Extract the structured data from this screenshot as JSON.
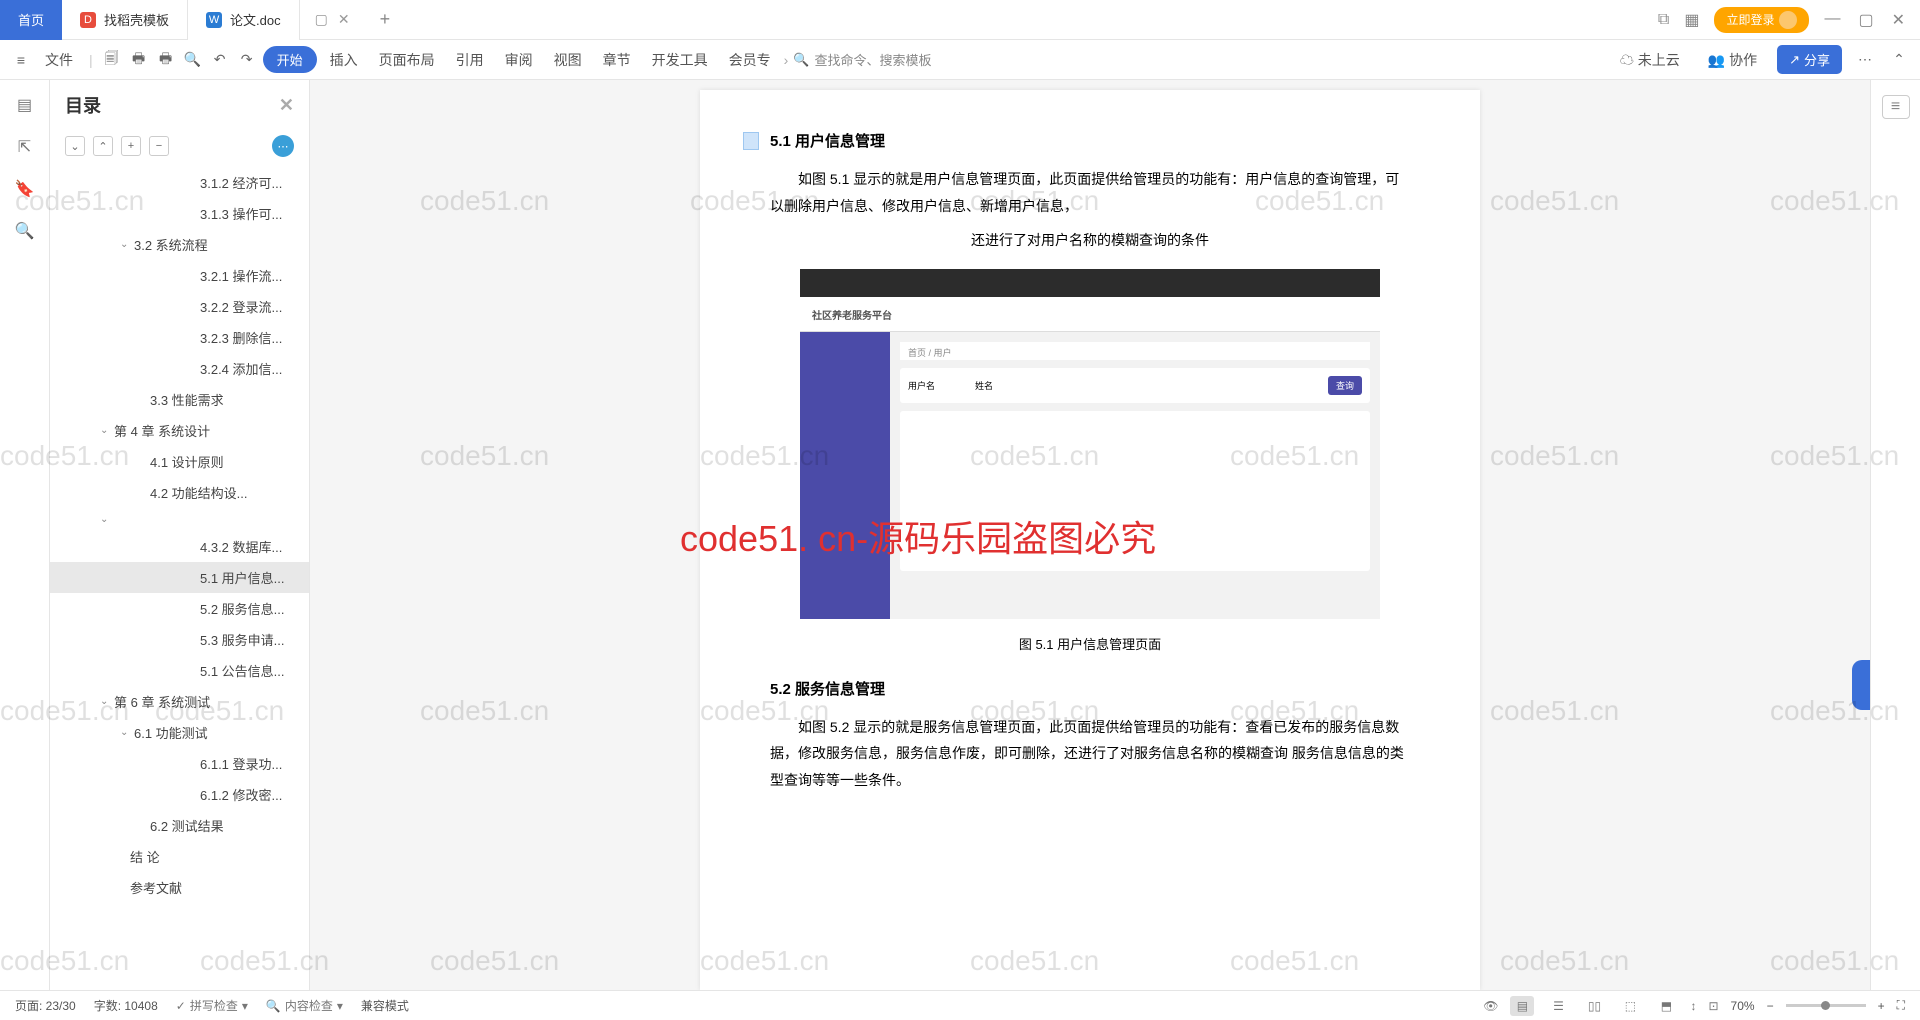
{
  "tabs": {
    "home": "首页",
    "templates": "找稻壳模板",
    "doc": "论文.doc"
  },
  "title_right": {
    "login": "立即登录"
  },
  "toolbar": {
    "file": "文件",
    "start": "开始",
    "insert": "插入",
    "layout": "页面布局",
    "refs": "引用",
    "review": "审阅",
    "view": "视图",
    "chapter": "章节",
    "dev": "开发工具",
    "member": "会员专",
    "search": "查找命令、搜索模板",
    "cloud": "未上云",
    "collab": "协作",
    "share": "分享"
  },
  "outline": {
    "title": "目录",
    "items": [
      {
        "label": "3.1.2 经济可...",
        "lvl": "ol-lv2"
      },
      {
        "label": "3.1.3 操作可...",
        "lvl": "ol-lv2"
      },
      {
        "label": "3.2 系统流程",
        "lvl": "ol-lv1c",
        "chev": "⌄"
      },
      {
        "label": "3.2.1 操作流...",
        "lvl": "ol-lv2"
      },
      {
        "label": "3.2.2 登录流...",
        "lvl": "ol-lv2"
      },
      {
        "label": "3.2.3 删除信...",
        "lvl": "ol-lv2"
      },
      {
        "label": "3.2.4 添加信...",
        "lvl": "ol-lv2"
      },
      {
        "label": "3.3 性能需求",
        "lvl": "ol-lv1"
      },
      {
        "label": "第 4 章  系统设计",
        "lvl": "ol-lv0c",
        "chev": "⌄"
      },
      {
        "label": "4.1 设计原则",
        "lvl": "ol-lv1"
      },
      {
        "label": "4.2 功能结构设...",
        "lvl": "ol-lv1"
      },
      {
        "label": "",
        "lvl": "ol-lv0c",
        "chev": "⌄"
      },
      {
        "label": "4.3.2 数据库...",
        "lvl": "ol-lv2"
      },
      {
        "label": "5.1 用户信息...",
        "lvl": "ol-lv2",
        "selected": true
      },
      {
        "label": "5.2 服务信息...",
        "lvl": "ol-lv2"
      },
      {
        "label": "5.3 服务申请...",
        "lvl": "ol-lv2"
      },
      {
        "label": "5.1 公告信息...",
        "lvl": "ol-lv2"
      },
      {
        "label": "第 6 章  系统测试",
        "lvl": "ol-lv0c",
        "chev": "⌄"
      },
      {
        "label": "6.1 功能测试",
        "lvl": "ol-lv1c",
        "chev": "⌄"
      },
      {
        "label": "6.1.1 登录功...",
        "lvl": "ol-lv2"
      },
      {
        "label": "6.1.2 修改密...",
        "lvl": "ol-lv2"
      },
      {
        "label": "6.2 测试结果",
        "lvl": "ol-lv1"
      },
      {
        "label": "结   论",
        "lvl": "ol-lv0"
      },
      {
        "label": "参考文献",
        "lvl": "ol-lv0"
      }
    ]
  },
  "doc": {
    "h51": "5.1 用户信息管理",
    "p51a": "如图 5.1 显示的就是用户信息管理页面，此页面提供给管理员的功能有：用户信息的查询管理，可以删除用户信息、修改用户信息、新增用户信息，",
    "p51b": "还进行了对用户名称的模糊查询的条件",
    "figapp": "社区养老服务平台",
    "figcap": "图 5.1  用户信息管理页面",
    "h52": "5.2  服务信息管理",
    "p52": "如图 5.2 显示的就是服务信息管理页面，此页面提供给管理员的功能有：查看已发布的服务信息数据，修改服务信息，服务信息作废，即可删除，还进行了对服务信息名称的模糊查询  服务信息信息的类型查询等等一些条件。"
  },
  "watermark": {
    "text": "code51.cn",
    "red": "code51. cn-源码乐园盗图必究"
  },
  "status": {
    "page": "页面: 23/30",
    "words": "字数: 10408",
    "spell": "拼写检查",
    "content": "内容检查",
    "compat": "兼容模式",
    "zoom": "70%"
  }
}
